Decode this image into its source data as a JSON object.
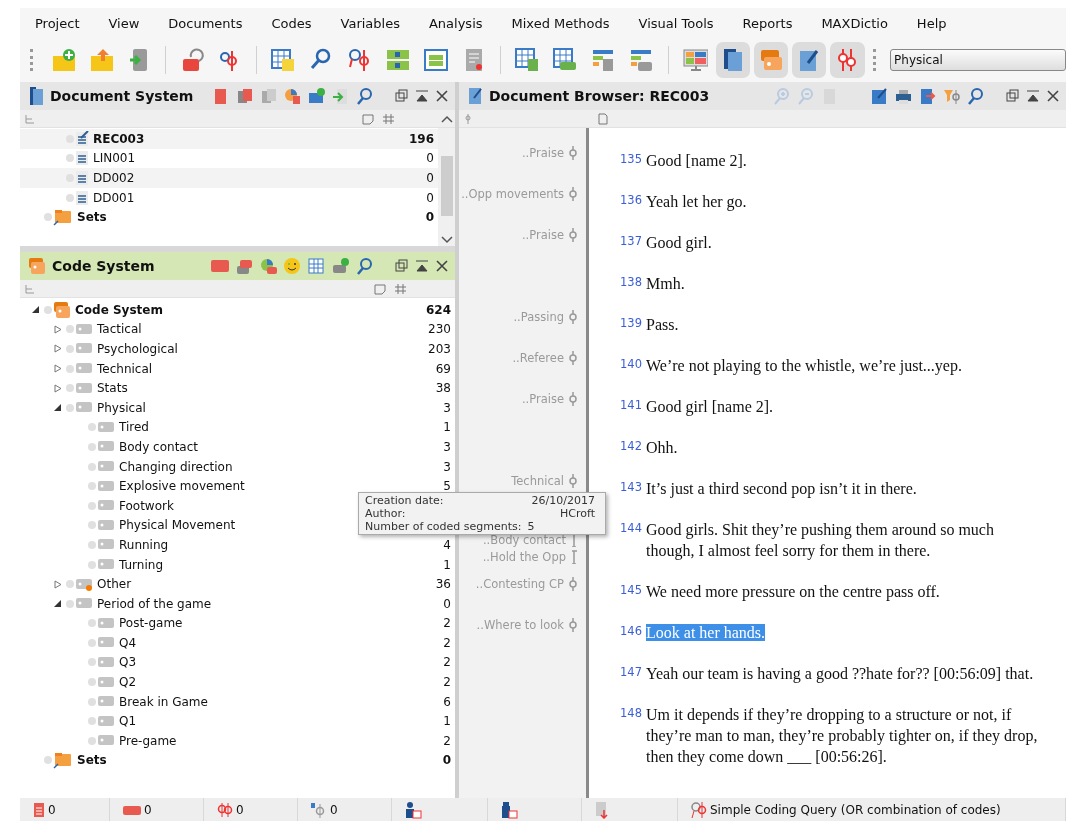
{
  "menu": [
    "Project",
    "View",
    "Documents",
    "Codes",
    "Variables",
    "Analysis",
    "Mixed Methods",
    "Visual Tools",
    "Reports",
    "MAXDictio",
    "Help"
  ],
  "toolbar": {
    "panel_toggles": [
      {
        "pressed": true
      },
      {
        "pressed": true
      },
      {
        "pressed": true
      },
      {
        "pressed": true
      }
    ],
    "code_dropdown": {
      "value": "Physical"
    }
  },
  "document_system": {
    "title": "Document System",
    "rows": [
      {
        "kind": "document",
        "name": "REC003",
        "count": "196",
        "open": true
      },
      {
        "kind": "document",
        "name": "LIN001",
        "count": "0",
        "open": false
      },
      {
        "kind": "document",
        "name": "DD002",
        "count": "0",
        "open": false
      },
      {
        "kind": "document",
        "name": "DD001",
        "count": "0",
        "open": false
      },
      {
        "kind": "set",
        "name": "Sets",
        "count": "0"
      }
    ]
  },
  "code_system": {
    "title": "Code System",
    "tree": [
      {
        "kind": "root",
        "name": "Code System",
        "count": "624",
        "expanded": true,
        "children": [
          {
            "kind": "code",
            "name": "Tactical",
            "count": "230",
            "expanded": false
          },
          {
            "kind": "code",
            "name": "Psychological",
            "count": "203",
            "expanded": false
          },
          {
            "kind": "code",
            "name": "Technical",
            "count": "69",
            "expanded": false
          },
          {
            "kind": "code",
            "name": "Stats",
            "count": "38",
            "expanded": false
          },
          {
            "kind": "code",
            "name": "Physical",
            "count": "3",
            "expanded": true,
            "children": [
              {
                "kind": "code",
                "name": "Tired",
                "count": "1"
              },
              {
                "kind": "code",
                "name": "Body contact",
                "count": "3"
              },
              {
                "kind": "code",
                "name": "Changing direction",
                "count": "3"
              },
              {
                "kind": "code",
                "name": "Explosive movement",
                "count": "5"
              },
              {
                "kind": "code",
                "name": "Footwork"
              },
              {
                "kind": "code",
                "name": "Physical Movement"
              },
              {
                "kind": "code",
                "name": "Running",
                "count": "4"
              },
              {
                "kind": "code",
                "name": "Turning",
                "count": "1"
              }
            ]
          },
          {
            "kind": "code",
            "name": "Other",
            "count": "36",
            "expanded": false,
            "color": "#f57c00"
          },
          {
            "kind": "code",
            "name": "Period of the game",
            "count": "0",
            "expanded": true,
            "children": [
              {
                "kind": "code",
                "name": "Post-game",
                "count": "2"
              },
              {
                "kind": "code",
                "name": "Q4",
                "count": "2"
              },
              {
                "kind": "code",
                "name": "Q3",
                "count": "2"
              },
              {
                "kind": "code",
                "name": "Q2",
                "count": "2"
              },
              {
                "kind": "code",
                "name": "Break in Game",
                "count": "6"
              },
              {
                "kind": "code",
                "name": "Q1",
                "count": "1"
              },
              {
                "kind": "code",
                "name": "Pre-game",
                "count": "2"
              }
            ]
          }
        ]
      },
      {
        "kind": "set",
        "name": "Sets",
        "count": "0"
      }
    ]
  },
  "tooltip": {
    "rows": [
      {
        "label": "Creation date:",
        "value": "26/10/2017"
      },
      {
        "label": "Author:",
        "value": "HCroft"
      },
      {
        "label": "Number of coded segments:",
        "value": "5"
      }
    ]
  },
  "document_browser": {
    "title": "Document Browser: REC003",
    "paragraphs": [
      {
        "number": "135",
        "text": "Good [name 2].",
        "codes": [
          "..Praise"
        ],
        "selected": false
      },
      {
        "number": "136",
        "text": "Yeah let her go.",
        "codes": [
          "..Opp movements"
        ],
        "selected": false
      },
      {
        "number": "137",
        "text": "Good girl.",
        "codes": [
          "..Praise"
        ],
        "selected": false
      },
      {
        "number": "138",
        "text": "Mmh.",
        "selected": false
      },
      {
        "number": "139",
        "text": "Pass.",
        "codes": [
          "..Passing"
        ],
        "selected": false
      },
      {
        "number": "140",
        "text": "We’re not playing to the whistle, we’re just...yep.",
        "codes": [
          "..Referee"
        ],
        "selected": false
      },
      {
        "number": "141",
        "text": "Good girl [name 2].",
        "codes": [
          "..Praise"
        ],
        "selected": false
      },
      {
        "number": "142",
        "text": "Ohh.",
        "selected": false
      },
      {
        "number": "143",
        "text": "It’s just a third second pop isn’t it in there.",
        "codes": [
          "Technical"
        ],
        "selected": false
      },
      {
        "number": "144",
        "text": "Good girls.  Shit they’re pushing them around so much though, I almost feel sorry for them in there.",
        "codes": [
          "..Body contact",
          "..Hold the Opp"
        ],
        "selected": false
      },
      {
        "number": "145",
        "text": "We need more pressure on the centre pass off.",
        "codes": [
          "..Contesting CP"
        ],
        "selected": false
      },
      {
        "number": "146",
        "text": "Look at her hands.",
        "codes": [
          "..Where to look"
        ],
        "selected": true
      },
      {
        "number": "147",
        "text": "Yeah our team is having a good ??hate for?? [00:56:09] that.",
        "selected": false
      },
      {
        "number": "148",
        "text": "Um it depends if they’re dropping to a structure or not, if they’re man to man, they’re probably tighter on, if they drop, then they come down ___ [00:56:26].",
        "selected": false
      }
    ]
  },
  "status_bar": [
    {
      "kind": "documents",
      "value": "0"
    },
    {
      "kind": "codes",
      "value": "0"
    },
    {
      "kind": "segments",
      "value": "0"
    },
    {
      "kind": "memos",
      "value": "0"
    },
    {
      "kind": "doc-variables"
    },
    {
      "kind": "code-variables"
    },
    {
      "kind": "import"
    },
    {
      "kind": "query",
      "value": "Simple Coding Query (OR combination of codes)"
    }
  ]
}
